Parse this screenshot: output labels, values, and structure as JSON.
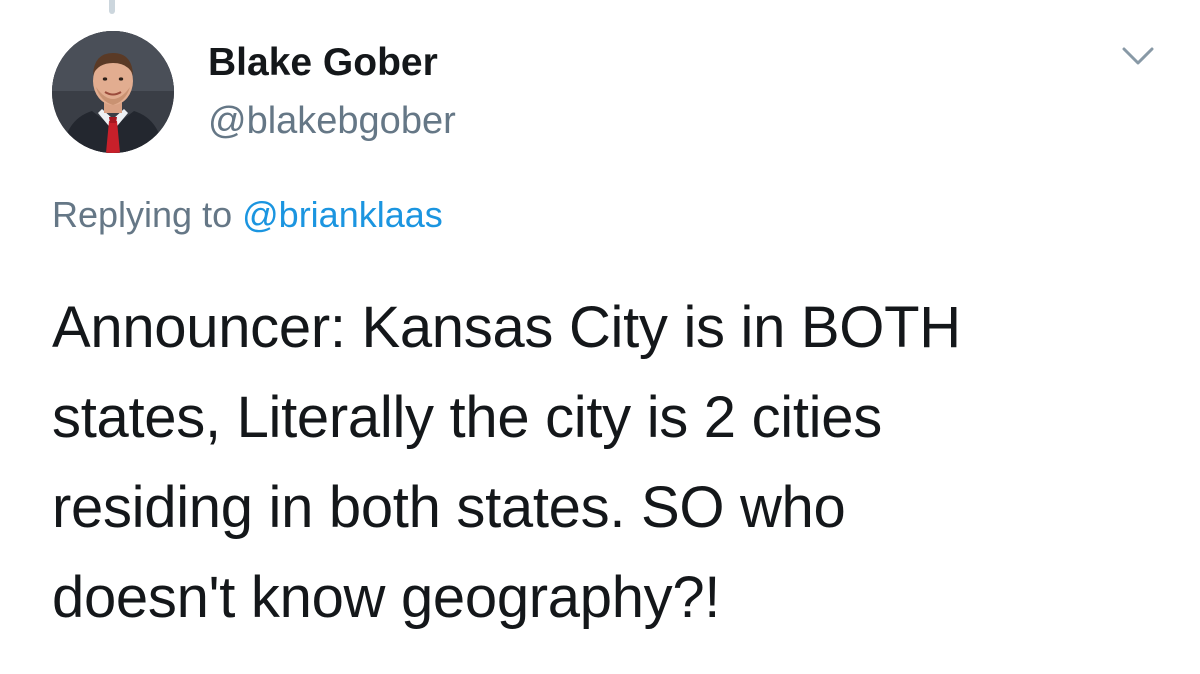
{
  "tweet": {
    "author": {
      "display_name": "Blake Gober",
      "handle": "@blakebgober",
      "avatar_icon": "profile-photo-man-suit-red-tie"
    },
    "menu_icon": "chevron-down-icon",
    "replying_to": {
      "prefix": "Replying to",
      "mention": "@brianklaas"
    },
    "text_lines": [
      "Announcer: Kansas City is in BOTH",
      "states, Literally the city is 2 cities",
      "residing in both states. SO who",
      "doesn't know geography?!"
    ]
  },
  "colors": {
    "primary_text": "#14171a",
    "secondary_text": "#657786",
    "link": "#1b95e0",
    "thread_line": "#ccd6dd"
  }
}
